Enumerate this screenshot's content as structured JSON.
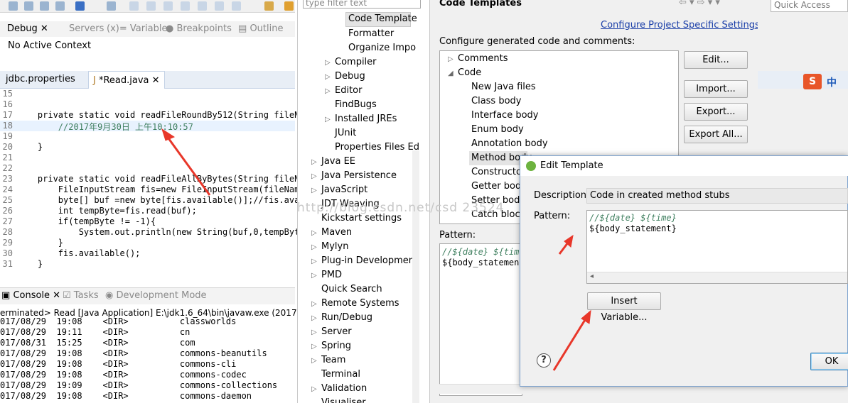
{
  "debug_view": {
    "tabs": [
      "Debug",
      "Servers",
      "Variables",
      "Breakpoints",
      "Outline"
    ],
    "no_context": "No Active Context"
  },
  "editor": {
    "tabs": [
      "jdbc.properties",
      "*Read.java"
    ],
    "lines": [
      {
        "no": "15",
        "text": ""
      },
      {
        "no": "16",
        "text": ""
      },
      {
        "no": "17",
        "text": "    private static void readFileRoundBy512(String fileNa"
      },
      {
        "no": "18",
        "text": "        //2017年9月30日 上午10:10:57"
      },
      {
        "no": "19",
        "text": ""
      },
      {
        "no": "20",
        "text": "    }"
      },
      {
        "no": "21",
        "text": ""
      },
      {
        "no": "22",
        "text": ""
      },
      {
        "no": "23",
        "text": "    private static void readFileAllByBytes(String fileNa"
      },
      {
        "no": "24",
        "text": "        FileInputStream fis=new FileInputStream(fileName"
      },
      {
        "no": "25",
        "text": "        byte[] buf =new byte[fis.available()];//fis.avai"
      },
      {
        "no": "26",
        "text": "        int tempByte=fis.read(buf);"
      },
      {
        "no": "27",
        "text": "        if(tempByte != -1){"
      },
      {
        "no": "28",
        "text": "            System.out.println(new String(buf,0,tempByte"
      },
      {
        "no": "29",
        "text": "        }"
      },
      {
        "no": "30",
        "text": "        fis.available();"
      },
      {
        "no": "31",
        "text": "    }"
      }
    ]
  },
  "console": {
    "tabs": [
      "Console",
      "Tasks",
      "Development Mode"
    ],
    "header": "erminated> Read [Java Application] E:\\jdk1.6_64\\bin\\javaw.exe (2017年",
    "rows": [
      {
        "date": "017/08/29",
        "time": "19:08",
        "type": "<DIR>",
        "name": "classworlds"
      },
      {
        "date": "017/08/29",
        "time": "19:11",
        "type": "<DIR>",
        "name": "cn"
      },
      {
        "date": "017/08/31",
        "time": "15:25",
        "type": "<DIR>",
        "name": "com"
      },
      {
        "date": "017/08/29",
        "time": "19:08",
        "type": "<DIR>",
        "name": "commons-beanutils"
      },
      {
        "date": "017/08/29",
        "time": "19:08",
        "type": "<DIR>",
        "name": "commons-cli"
      },
      {
        "date": "017/08/29",
        "time": "19:08",
        "type": "<DIR>",
        "name": "commons-codec"
      },
      {
        "date": "017/08/29",
        "time": "19:09",
        "type": "<DIR>",
        "name": "commons-collections"
      },
      {
        "date": "017/08/29",
        "time": "19:08",
        "type": "<DIR>",
        "name": "commons-daemon"
      }
    ]
  },
  "prefs_tree": {
    "filter_placeholder": "type filter text",
    "java_code_style_children": [
      "Code Template",
      "Formatter",
      "Organize Impo"
    ],
    "java_children": [
      "Compiler",
      "Debug",
      "Editor",
      "FindBugs",
      "Installed JREs",
      "JUnit",
      "Properties Files Ed"
    ],
    "top_level": [
      "Java EE",
      "Java Persistence",
      "JavaScript",
      "JDT Weaving",
      "Kickstart settings",
      "Maven",
      "Mylyn",
      "Plug-in Development",
      "PMD",
      "Quick Search",
      "Remote Systems",
      "Run/Debug",
      "Server",
      "Spring",
      "Team",
      "Terminal",
      "Validation",
      "Visualiser"
    ]
  },
  "code_templates": {
    "title": "Code Templates",
    "project_link": "Configure Project Specific Settings...",
    "config_label": "Configure generated code and comments:",
    "tree": {
      "comments": "Comments",
      "code": "Code",
      "code_children": [
        "New Java files",
        "Class body",
        "Interface body",
        "Enum body",
        "Annotation body",
        "Method body",
        "Constructor",
        "Getter body",
        "Setter body",
        "Catch block"
      ]
    },
    "buttons": {
      "edit": "Edit...",
      "import": "Import...",
      "export": "Export...",
      "export_all": "Export All..."
    },
    "pattern_label": "Pattern:",
    "pattern_lines": [
      "//${date} ${time",
      "${body_statemen"
    ]
  },
  "quick_access": "Quick Access",
  "ime_label": "中",
  "edit_dialog": {
    "title": "Edit Template",
    "description_label": "Description:",
    "description_value": "Code in created method stubs",
    "pattern_label": "Pattern:",
    "pattern_lines": [
      "//${date} ${time}",
      "${body_statement}"
    ],
    "insert_variable": "Insert Variable...",
    "ok": "OK"
  },
  "watermark": "http://blog.csdn.net/csd        23524",
  "colors": {
    "annotation_arrow": "#e8372a",
    "link": "#1a3ea8",
    "keyword": "#7f0055",
    "comment": "#3f7f5f"
  }
}
